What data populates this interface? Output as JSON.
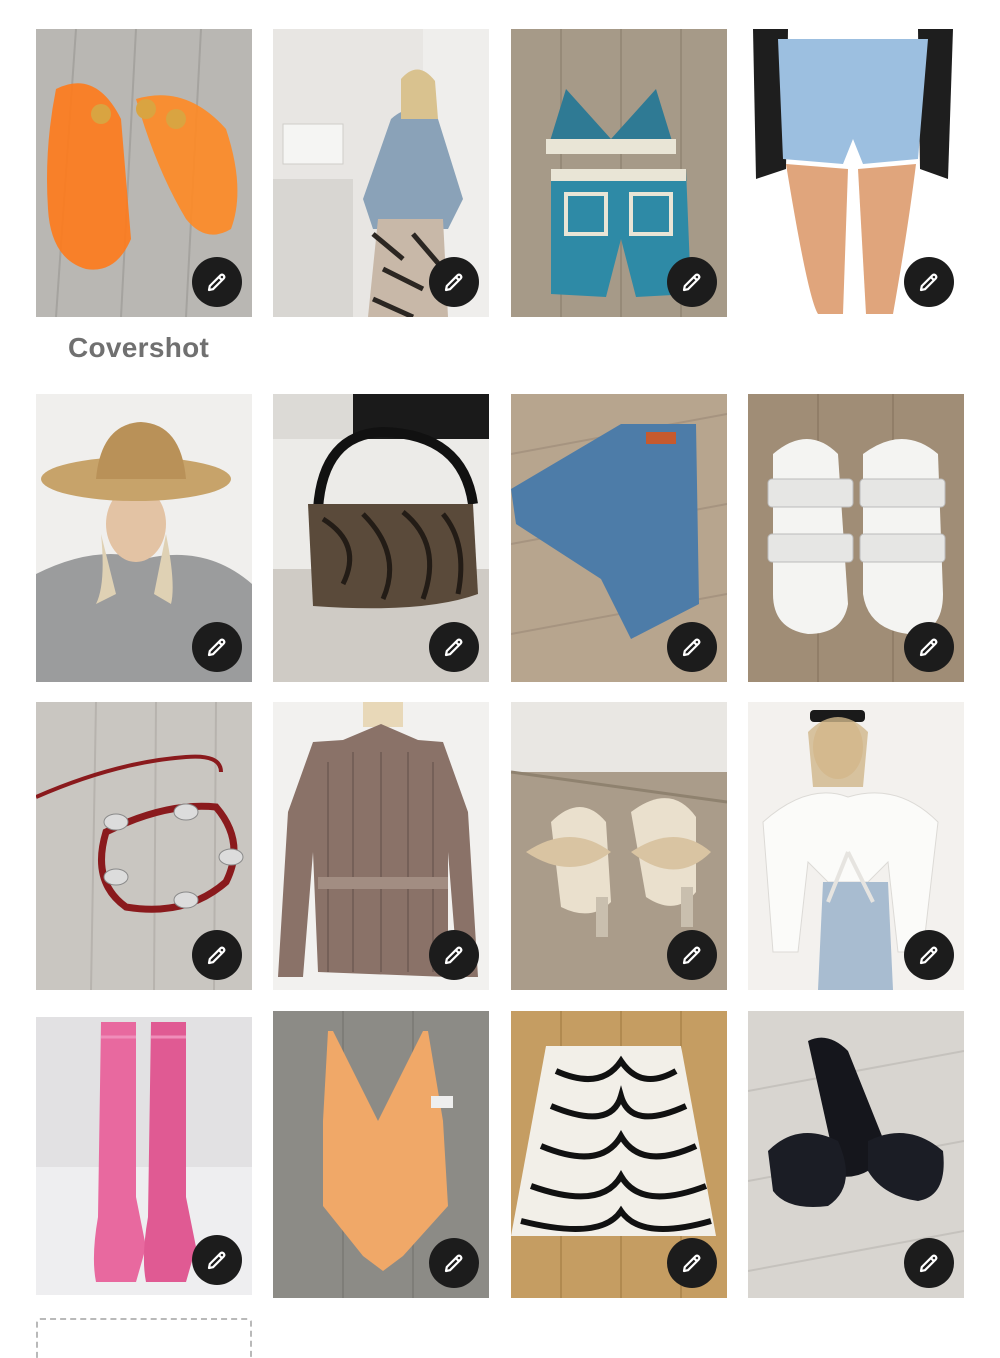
{
  "covershot_label": "Covershot",
  "edit_icon": "pencil-icon",
  "colors": {
    "edit_button_bg": "#1c1c1c",
    "label_text": "#707070"
  },
  "items": [
    {
      "name": "orange-jelly-sandals",
      "icon": "edit-pencil-icon"
    },
    {
      "name": "denim-jacket-zebra-pants-outfit",
      "icon": "edit-pencil-icon"
    },
    {
      "name": "blue-crochet-set",
      "icon": "edit-pencil-icon"
    },
    {
      "name": "denim-shorts",
      "icon": "edit-pencil-icon"
    },
    {
      "name": "straw-hat-sweatshirt",
      "icon": "edit-pencil-icon"
    },
    {
      "name": "zebra-shoulder-bag",
      "icon": "edit-pencil-icon"
    },
    {
      "name": "levis-jeans",
      "icon": "edit-pencil-icon"
    },
    {
      "name": "white-buckle-slides",
      "icon": "edit-pencil-icon"
    },
    {
      "name": "red-concho-belt",
      "icon": "edit-pencil-icon"
    },
    {
      "name": "pleated-wrap-top",
      "icon": "edit-pencil-icon"
    },
    {
      "name": "bow-heeled-sandals",
      "icon": "edit-pencil-icon"
    },
    {
      "name": "white-eyelet-tie-top",
      "icon": "edit-pencil-icon"
    },
    {
      "name": "pink-rain-boots",
      "icon": "edit-pencil-icon"
    },
    {
      "name": "peach-swimsuit",
      "icon": "edit-pencil-icon"
    },
    {
      "name": "zebra-print-skirt",
      "icon": "edit-pencil-icon"
    },
    {
      "name": "black-bow-slides",
      "icon": "edit-pencil-icon"
    }
  ]
}
